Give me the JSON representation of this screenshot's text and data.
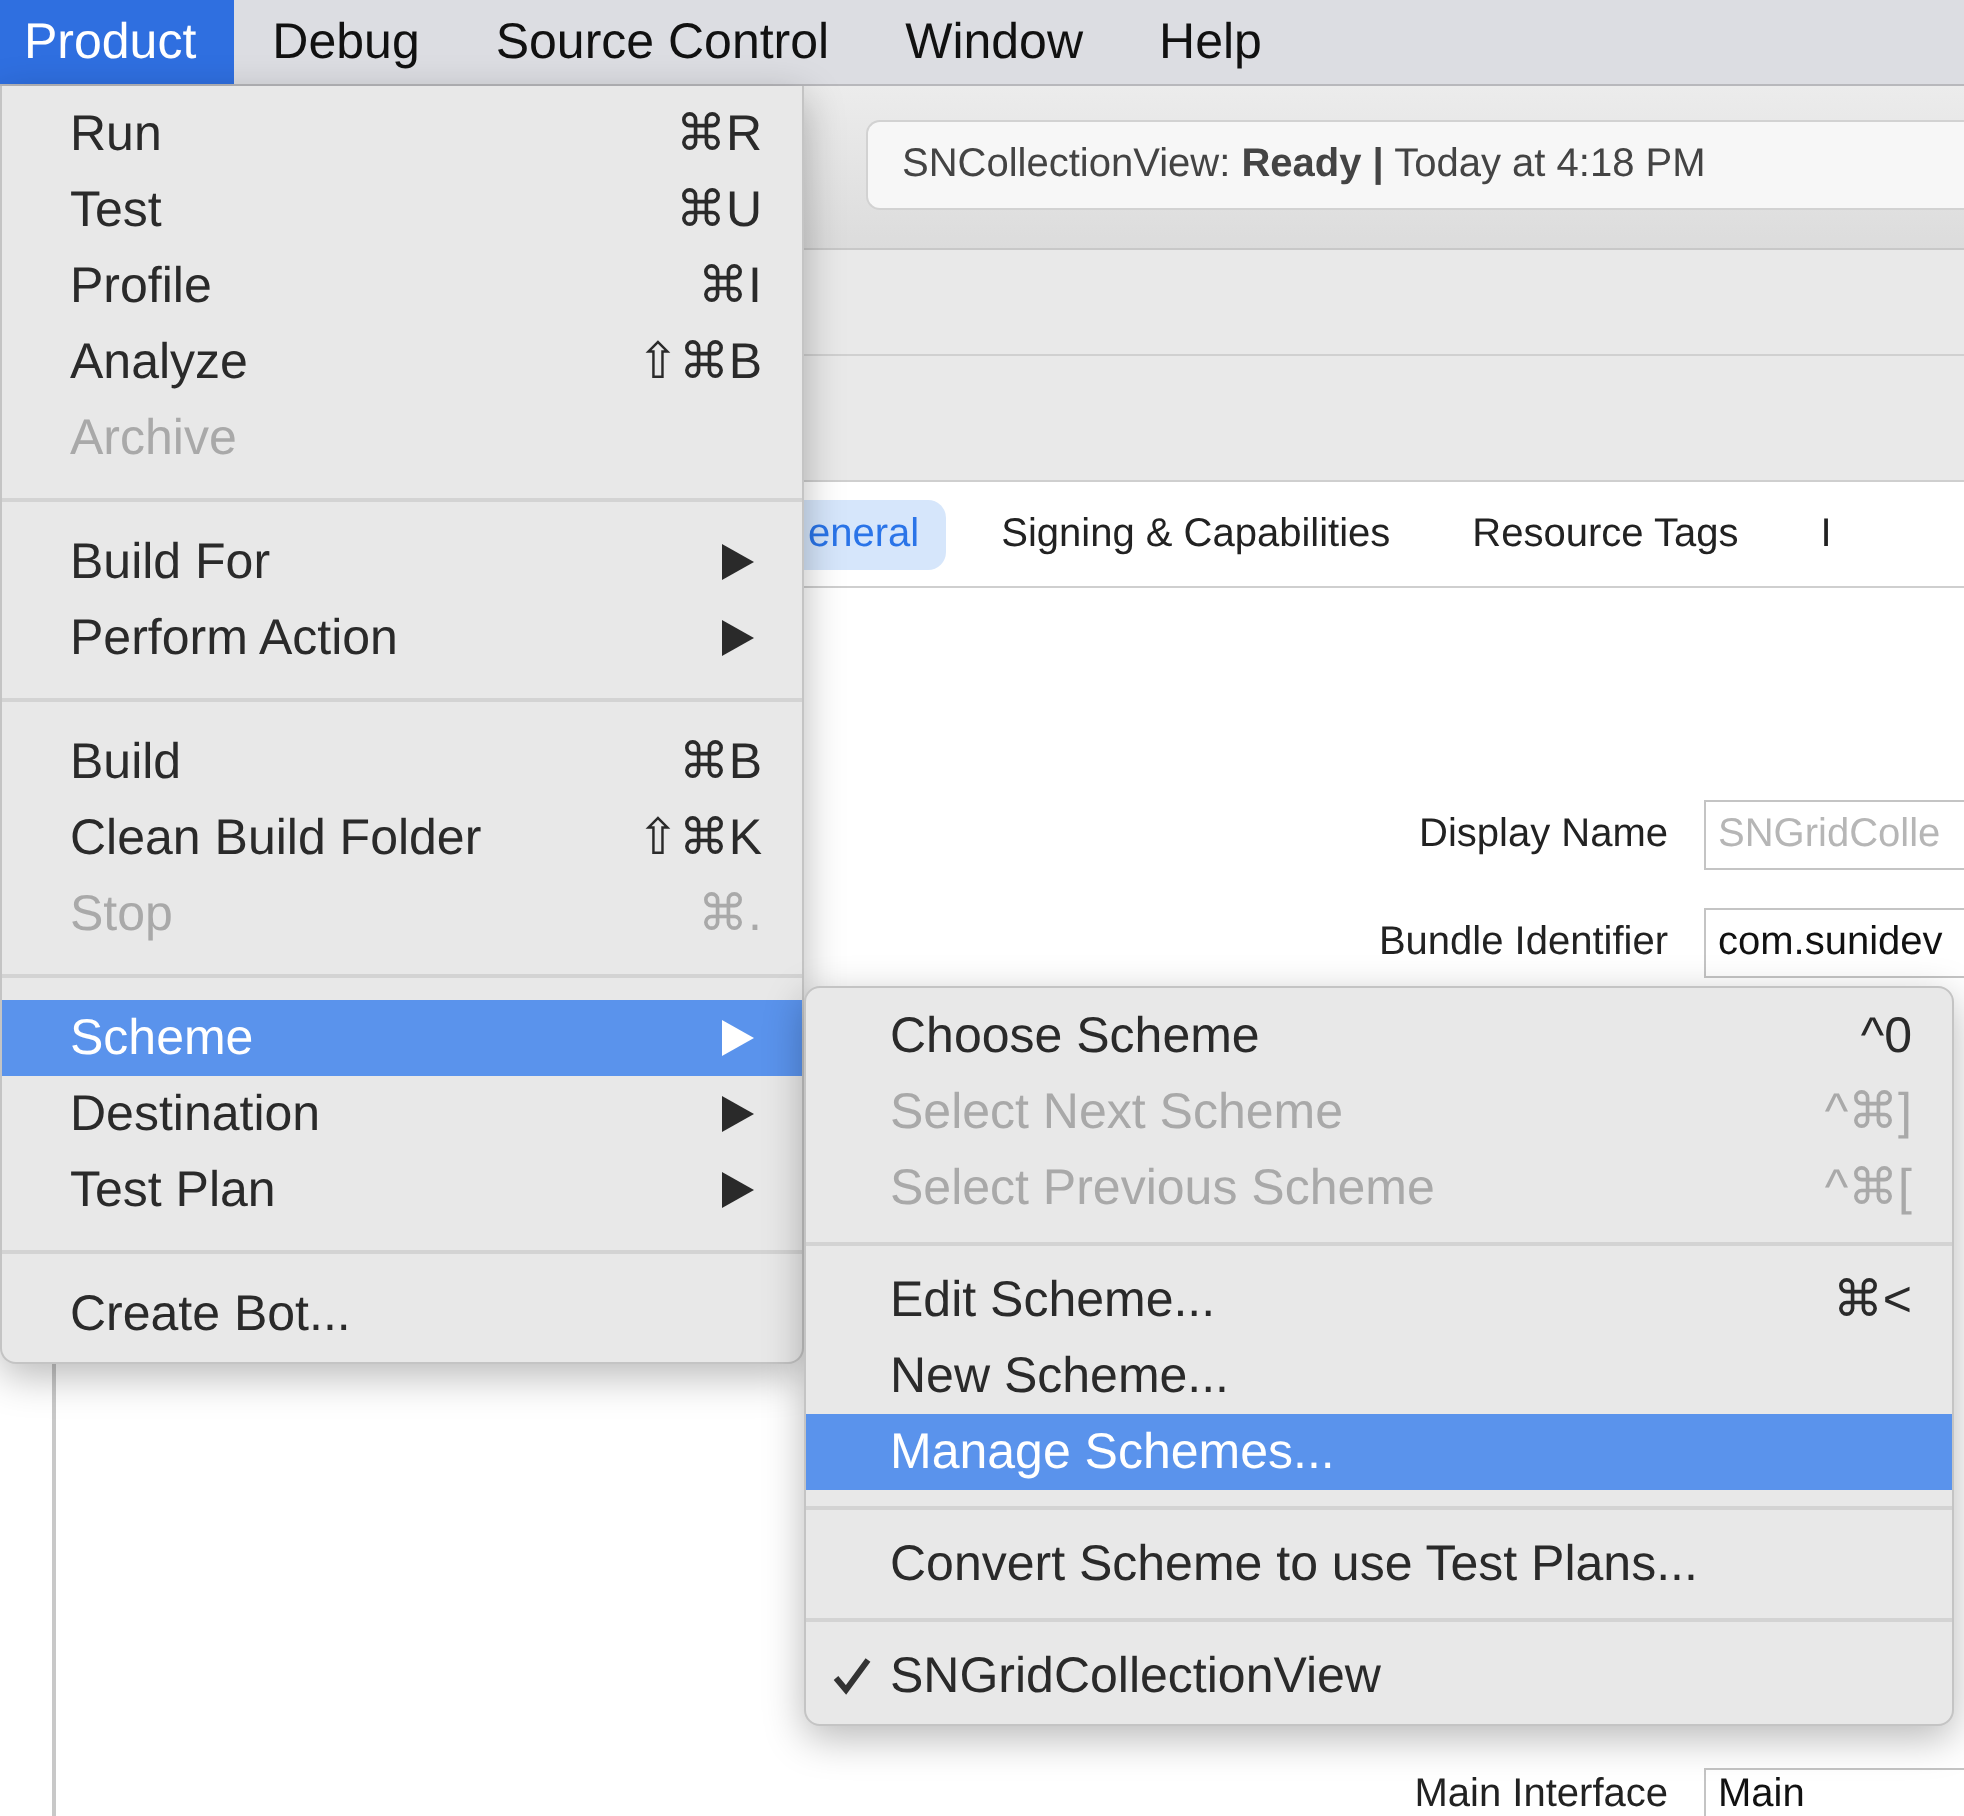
{
  "menu_bar": [
    {
      "label": "Product",
      "selected": true
    },
    {
      "label": "Debug",
      "selected": false
    },
    {
      "label": "Source Control",
      "selected": false
    },
    {
      "label": "Window",
      "selected": false
    },
    {
      "label": "Help",
      "selected": false
    }
  ],
  "status": {
    "text": "SNCollectionView: **Ready |** Today at 4:18 PM"
  },
  "tabs": [
    {
      "label": "eneral",
      "selected": true
    },
    {
      "label": "Signing & Capabilities",
      "selected": false
    },
    {
      "label": "Resource Tags",
      "selected": false
    },
    {
      "label": "I",
      "selected": false
    }
  ],
  "fields": [
    {
      "label": "Display Name",
      "placeholder": "SNGridColle"
    },
    {
      "label": "Bundle Identifier",
      "value": "com.sunidev"
    },
    {
      "label": "Main Interface",
      "value": "Main"
    }
  ],
  "product_menu": [
    [
      {
        "label": "Run",
        "shortcut": "⌘R",
        "disabled": false,
        "selected": false,
        "submenu": false
      },
      {
        "label": "Test",
        "shortcut": "⌘U",
        "disabled": false,
        "selected": false,
        "submenu": false
      },
      {
        "label": "Profile",
        "shortcut": "⌘I",
        "disabled": false,
        "selected": false,
        "submenu": false
      },
      {
        "label": "Analyze",
        "shortcut": "⇧⌘B",
        "disabled": false,
        "selected": false,
        "submenu": false
      },
      {
        "label": "Archive",
        "disabled": true,
        "selected": false,
        "submenu": false
      }
    ],
    [
      {
        "label": "Build For",
        "disabled": false,
        "selected": false,
        "submenu": true
      },
      {
        "label": "Perform Action",
        "disabled": false,
        "selected": false,
        "submenu": true
      }
    ],
    [
      {
        "label": "Build",
        "shortcut": "⌘B",
        "disabled": false,
        "selected": false,
        "submenu": false
      },
      {
        "label": "Clean Build Folder",
        "shortcut": "⇧⌘K",
        "disabled": false,
        "selected": false,
        "submenu": false
      },
      {
        "label": "Stop",
        "shortcut": "⌘.",
        "disabled": true,
        "selected": false,
        "submenu": false
      }
    ],
    [
      {
        "label": "Scheme",
        "disabled": false,
        "selected": true,
        "submenu": true
      },
      {
        "label": "Destination",
        "disabled": false,
        "selected": false,
        "submenu": true
      },
      {
        "label": "Test Plan",
        "disabled": false,
        "selected": false,
        "submenu": true
      }
    ],
    [
      {
        "label": "Create Bot...",
        "disabled": false,
        "selected": false,
        "submenu": false
      }
    ]
  ],
  "scheme_menu": [
    [
      {
        "label": "Choose Scheme",
        "shortcut": "^0",
        "disabled": false,
        "selected": false,
        "checked": false
      },
      {
        "label": "Select Next Scheme",
        "shortcut": "^⌘]",
        "disabled": true,
        "selected": false,
        "checked": false
      },
      {
        "label": "Select Previous Scheme",
        "shortcut": "^⌘[",
        "disabled": true,
        "selected": false,
        "checked": false
      }
    ],
    [
      {
        "label": "Edit Scheme...",
        "shortcut": "⌘<",
        "disabled": false,
        "selected": false,
        "checked": false
      },
      {
        "label": "New Scheme...",
        "disabled": false,
        "selected": false,
        "checked": false
      },
      {
        "label": "Manage Schemes...",
        "disabled": false,
        "selected": true,
        "checked": false
      }
    ],
    [
      {
        "label": "Convert Scheme to use Test Plans...",
        "disabled": false,
        "selected": false,
        "checked": false
      }
    ],
    [
      {
        "label": "SNGridCollectionView",
        "disabled": false,
        "selected": false,
        "checked": true
      }
    ]
  ]
}
